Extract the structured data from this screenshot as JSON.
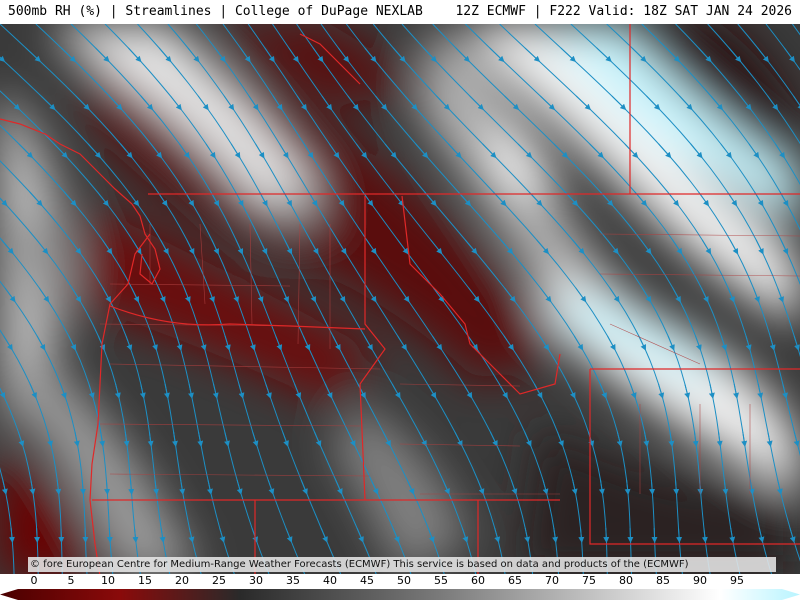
{
  "header": {
    "left_title": "500mb RH (%) | Streamlines | College of DuPage NEXLAB",
    "right_title": "12Z ECMWF | F222 Valid: 18Z SAT JAN 24 2026"
  },
  "map": {
    "field": "500mb RH (%)",
    "overlay": "Streamlines",
    "streamline_color": "#1d8fc4",
    "boundary_color": "#e02828",
    "county_color": "#b04040"
  },
  "credit": {
    "text": "© fore European Centre for Medium-Range Weather Forecasts (ECMWF)  This service is based on data and products of the (ECMWF)"
  },
  "colorbar": {
    "labels": [
      "0",
      "5",
      "10",
      "15",
      "20",
      "25",
      "30",
      "35",
      "40",
      "45",
      "50",
      "55",
      "60",
      "65",
      "70",
      "75",
      "80",
      "85",
      "90",
      "95"
    ],
    "min": 0,
    "max": 100,
    "stops": [
      {
        "value": 0,
        "color": "#4a0000"
      },
      {
        "value": 15,
        "color": "#8a0a0a"
      },
      {
        "value": 30,
        "color": "#2a2a2a"
      },
      {
        "value": 55,
        "color": "#7a7a7a"
      },
      {
        "value": 80,
        "color": "#d9d9d9"
      },
      {
        "value": 90,
        "color": "#ffffff"
      },
      {
        "value": 100,
        "color": "#b8f4ff"
      }
    ]
  }
}
